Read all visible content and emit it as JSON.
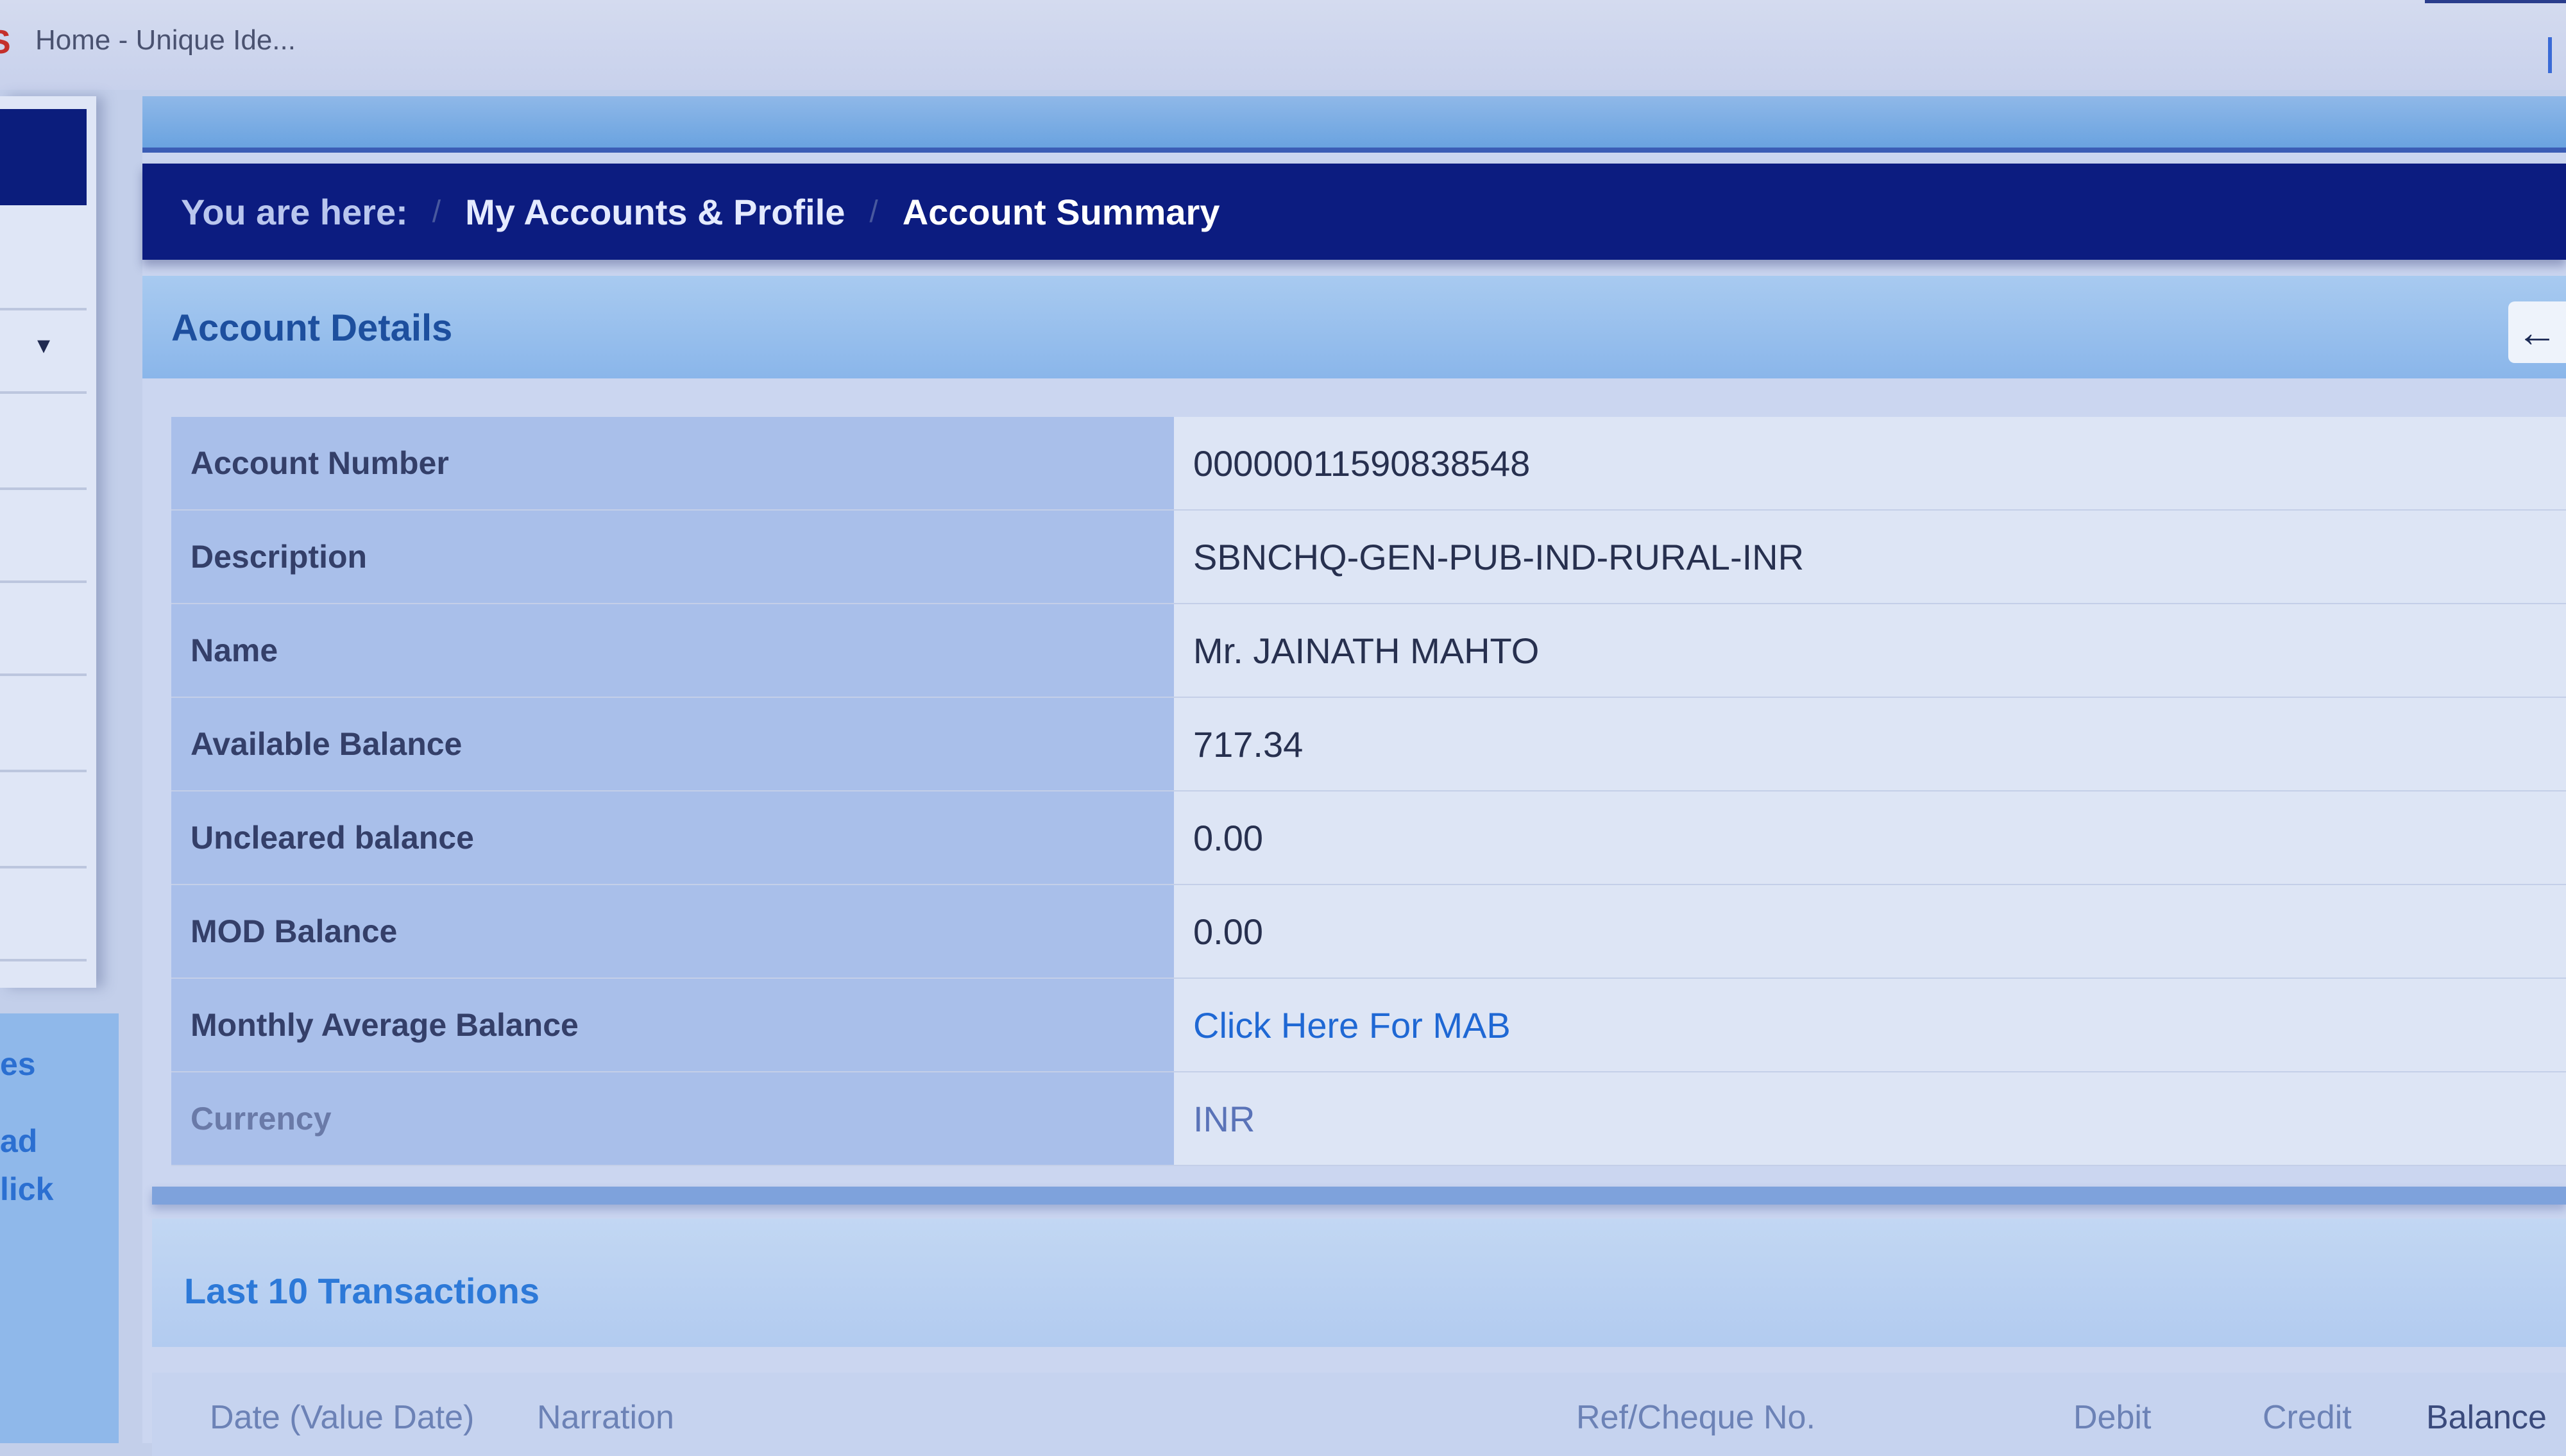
{
  "browser": {
    "tab_title": "Home - Unique Ide..."
  },
  "breadcrumb": {
    "prefix": "You are here:",
    "items": [
      "My Accounts & Profile",
      "Account Summary"
    ]
  },
  "account_details": {
    "title": "Account Details",
    "rows": [
      {
        "label": "Account Number",
        "value": "00000011590838548"
      },
      {
        "label": "Description",
        "value": "SBNCHQ-GEN-PUB-IND-RURAL-INR"
      },
      {
        "label": "Name",
        "value": "Mr. JAINATH MAHTO"
      },
      {
        "label": "Available Balance",
        "value": "717.34"
      },
      {
        "label": "Uncleared balance",
        "value": "0.00"
      },
      {
        "label": "MOD Balance",
        "value": "0.00"
      },
      {
        "label": "Monthly Average Balance",
        "value": "Click Here For MAB"
      },
      {
        "label": "Currency",
        "value": "INR"
      }
    ]
  },
  "transactions": {
    "title": "Last 10 Transactions",
    "columns": [
      "Date (Value Date)",
      "Narration",
      "Ref/Cheque No.",
      "Debit",
      "Credit",
      "Balance"
    ]
  },
  "sidebar": {
    "fragments": [
      "es",
      "ad",
      "lick"
    ]
  },
  "colors": {
    "breadcrumb_bg": "#0c1c80",
    "panel_header_bg": "#8ab6ea",
    "link": "#1f68d4"
  }
}
